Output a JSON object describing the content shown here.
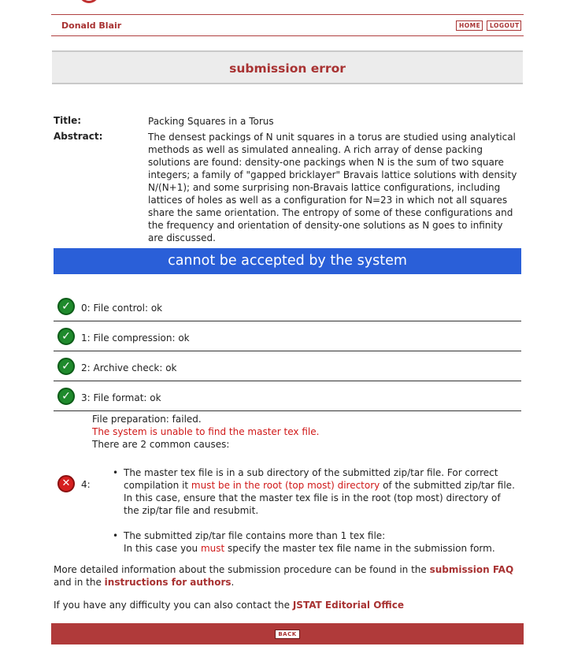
{
  "header": {
    "user_name": "Donald Blair",
    "home_label": "HOME",
    "logout_label": "LOGOUT"
  },
  "error_title": "submission error",
  "submission": {
    "title_label": "Title:",
    "title": "Packing Squares in a Torus",
    "abstract_label": "Abstract:",
    "abstract": "The densest packings of N unit squares in a torus are studied using analytical methods as well as simulated annealing. A rich array of dense packing solutions are found: density-one packings when N is the sum of two square integers; a family of \"gapped bricklayer\" Bravais lattice solutions with density N/(N+1); and some surprising non-Bravais lattice configurations, including lattices of holes as well as a configuration for N=23 in which not all squares share the same orientation. The entropy of some of these configurations and the frequency and orientation of density-one solutions as N goes to infinity are discussed."
  },
  "banner": "cannot be accepted by the system",
  "checks": [
    {
      "label": "0: File control: ok",
      "status": "ok"
    },
    {
      "label": "1: File compression: ok",
      "status": "ok"
    },
    {
      "label": "2: Archive check: ok",
      "status": "ok"
    },
    {
      "label": "3: File format: ok",
      "status": "ok"
    }
  ],
  "failed_check": {
    "number": "4:",
    "status": "failed",
    "heading": "File preparation: failed.",
    "error": "The system is unable to find the master tex file.",
    "intro": "There are 2 common causes:",
    "cause1_a": "The master tex file is in a sub directory of the submitted zip/tar file. For correct compilation it ",
    "cause1_red": "must be in the root (top most) directory",
    "cause1_b": " of the submitted zip/tar file. In this case, ensure that the master tex file is in the root (top most) directory of the zip/tar file and resubmit.",
    "cause2_line1": "The submitted zip/tar file contains more than 1 tex file:",
    "cause2_a": "In this case you ",
    "cause2_red": "must",
    "cause2_b": " specify the master tex file name in the submission form."
  },
  "info": {
    "text_a": "More detailed information about the submission procedure can be found in the ",
    "faq_link": "submission FAQ",
    "text_b": " and in the ",
    "instructions_link": "instructions for authors",
    "text_c": ".",
    "contact_text": "If you have any difficulty you can also contact the ",
    "office_link": "JSTAT Editorial Office"
  },
  "footer": {
    "back_label": "BACK"
  },
  "icons": {
    "ok": "check-circle-icon",
    "fail": "x-circle-icon"
  }
}
